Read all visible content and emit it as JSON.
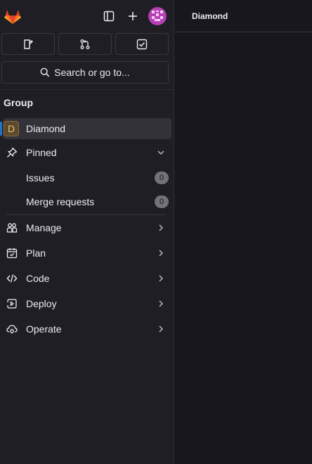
{
  "breadcrumb": {
    "current": "Diamond"
  },
  "search": {
    "label": "Search or go to..."
  },
  "sidebar": {
    "section_title": "Group",
    "group": {
      "avatar_letter": "D",
      "name": "Diamond"
    },
    "pinned": {
      "label": "Pinned",
      "items": [
        {
          "label": "Issues",
          "count": "0"
        },
        {
          "label": "Merge requests",
          "count": "0"
        }
      ]
    },
    "menu": [
      {
        "label": "Manage",
        "icon": "users-icon"
      },
      {
        "label": "Plan",
        "icon": "calendar-icon"
      },
      {
        "label": "Code",
        "icon": "code-icon"
      },
      {
        "label": "Deploy",
        "icon": "deploy-icon"
      },
      {
        "label": "Operate",
        "icon": "cloud-gear-icon"
      }
    ]
  },
  "colors": {
    "brand_orange": "#fc6d26",
    "active_bar": "#1f75cb",
    "avatar_bg": "#5c4a2e"
  }
}
